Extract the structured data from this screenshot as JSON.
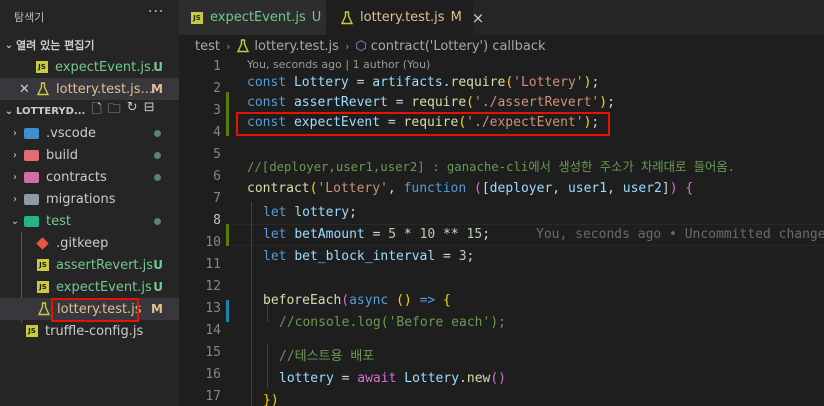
{
  "sidebar": {
    "title": "탐색기",
    "more_icon": "ellipsis-icon",
    "open_editors": {
      "label": "열려 있는 편집기",
      "items": [
        {
          "name": "expectEvent.js...",
          "badge": "U",
          "badge_color": "#73c991"
        },
        {
          "name": "lottery.test.js...",
          "badge": "M",
          "badge_color": "#e2c08d"
        }
      ]
    },
    "project": {
      "label": "LOTTERYD...",
      "action_icons": [
        "new-file-icon",
        "new-folder-icon",
        "refresh-icon",
        "collapse-all-icon"
      ],
      "items": [
        {
          "name": ".vscode",
          "type": "folder",
          "status": "dot"
        },
        {
          "name": "build",
          "type": "folder",
          "status": "dot"
        },
        {
          "name": "contracts",
          "type": "folder",
          "status": "dot"
        },
        {
          "name": "migrations",
          "type": "folder",
          "status": ""
        },
        {
          "name": "test",
          "type": "folder-open",
          "status": "dot"
        },
        {
          "name": ".gitkeep",
          "type": "git",
          "status": ""
        },
        {
          "name": "assertRevert.js",
          "type": "js",
          "status": "U"
        },
        {
          "name": "expectEvent.js",
          "type": "js",
          "status": "U"
        },
        {
          "name": "lottery.test.js",
          "type": "test",
          "status": "M"
        },
        {
          "name": "truffle-config.js",
          "type": "js",
          "status": ""
        }
      ]
    }
  },
  "tabs": [
    {
      "label": "expectEvent.js",
      "badge": "U"
    },
    {
      "label": "lottery.test.js",
      "badge": "M",
      "close": "×"
    }
  ],
  "breadcrumb": {
    "folder": "test",
    "file": "lottery.test.js",
    "symbol": "contract('Lottery') callback"
  },
  "editor": {
    "blame_header": "You, seconds ago | 1 author (You)",
    "line_numbers": [
      "1",
      "2",
      "3",
      "4",
      "5",
      "6",
      "7",
      "8",
      "9",
      "10",
      "11",
      "12",
      "13",
      "14",
      "15",
      "16",
      "17"
    ],
    "line9_blame": "You, seconds ago • Uncommitted changes",
    "code": {
      "l1": [
        "const",
        "Lottery",
        "=",
        "artifacts",
        "require",
        "'Lottery'"
      ],
      "l2": [
        "const",
        "assertRevert",
        "=",
        "require",
        "'./assertRevert'"
      ],
      "l3": [
        "const",
        "expectEvent",
        "=",
        "require",
        "'./expectEvent'"
      ],
      "l5": "//[deployer,user1,user2] : ganache-cli에서 생성한 주소가 차례대로 들어옴.",
      "l6": [
        "contract",
        "'Lottery'",
        "function",
        "deployer",
        "user1",
        "user2"
      ],
      "l8": [
        "let",
        "lottery"
      ],
      "l9": [
        "let",
        "betAmount",
        "=",
        "5",
        "*",
        "10",
        "**",
        "15"
      ],
      "l10": [
        "let",
        "bet_block_interval",
        "=",
        "3"
      ],
      "l12": [
        "beforeEach",
        "async"
      ],
      "l13": "//console.log('Before each');",
      "l15": "//테스트용 배포",
      "l16": [
        "lottery",
        "=",
        "await",
        "Lottery",
        "new"
      ],
      "l17": "})"
    }
  }
}
